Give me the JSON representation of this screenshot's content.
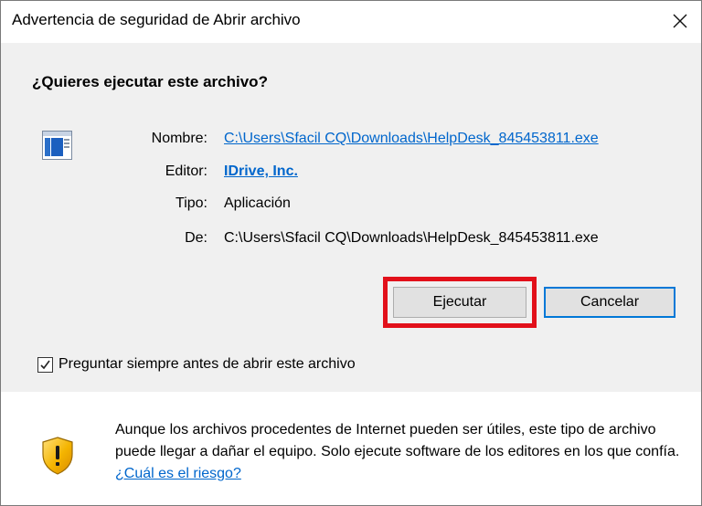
{
  "window": {
    "title": "Advertencia de seguridad de Abrir archivo"
  },
  "prompt": {
    "question": "¿Quieres ejecutar este archivo?"
  },
  "details": {
    "name_label": "Nombre:",
    "name_value": "C:\\Users\\Sfacil CQ\\Downloads\\HelpDesk_845453811.exe",
    "publisher_label": "Editor:",
    "publisher_value": "IDrive, Inc.",
    "type_label": "Tipo:",
    "type_value": "Aplicación",
    "from_label": "De:",
    "from_value": "C:\\Users\\Sfacil CQ\\Downloads\\HelpDesk_845453811.exe"
  },
  "buttons": {
    "run": "Ejecutar",
    "cancel": "Cancelar"
  },
  "checkbox": {
    "label": "Preguntar siempre antes de abrir este archivo",
    "checked": true
  },
  "warning": {
    "text": "Aunque los archivos procedentes de Internet pueden ser útiles, este tipo de archivo puede llegar a dañar el equipo. Solo ejecute software de los editores en los que confía. ",
    "link": "¿Cuál es el riesgo?"
  },
  "icons": {
    "close": "close-icon",
    "file": "application-file-icon",
    "shield": "security-shield-icon",
    "check": "checkmark-icon"
  },
  "colors": {
    "link": "#0066cc",
    "highlight": "#e2101a",
    "default_button_border": "#0078d7",
    "upper_pane_bg": "#f0f0f0"
  }
}
